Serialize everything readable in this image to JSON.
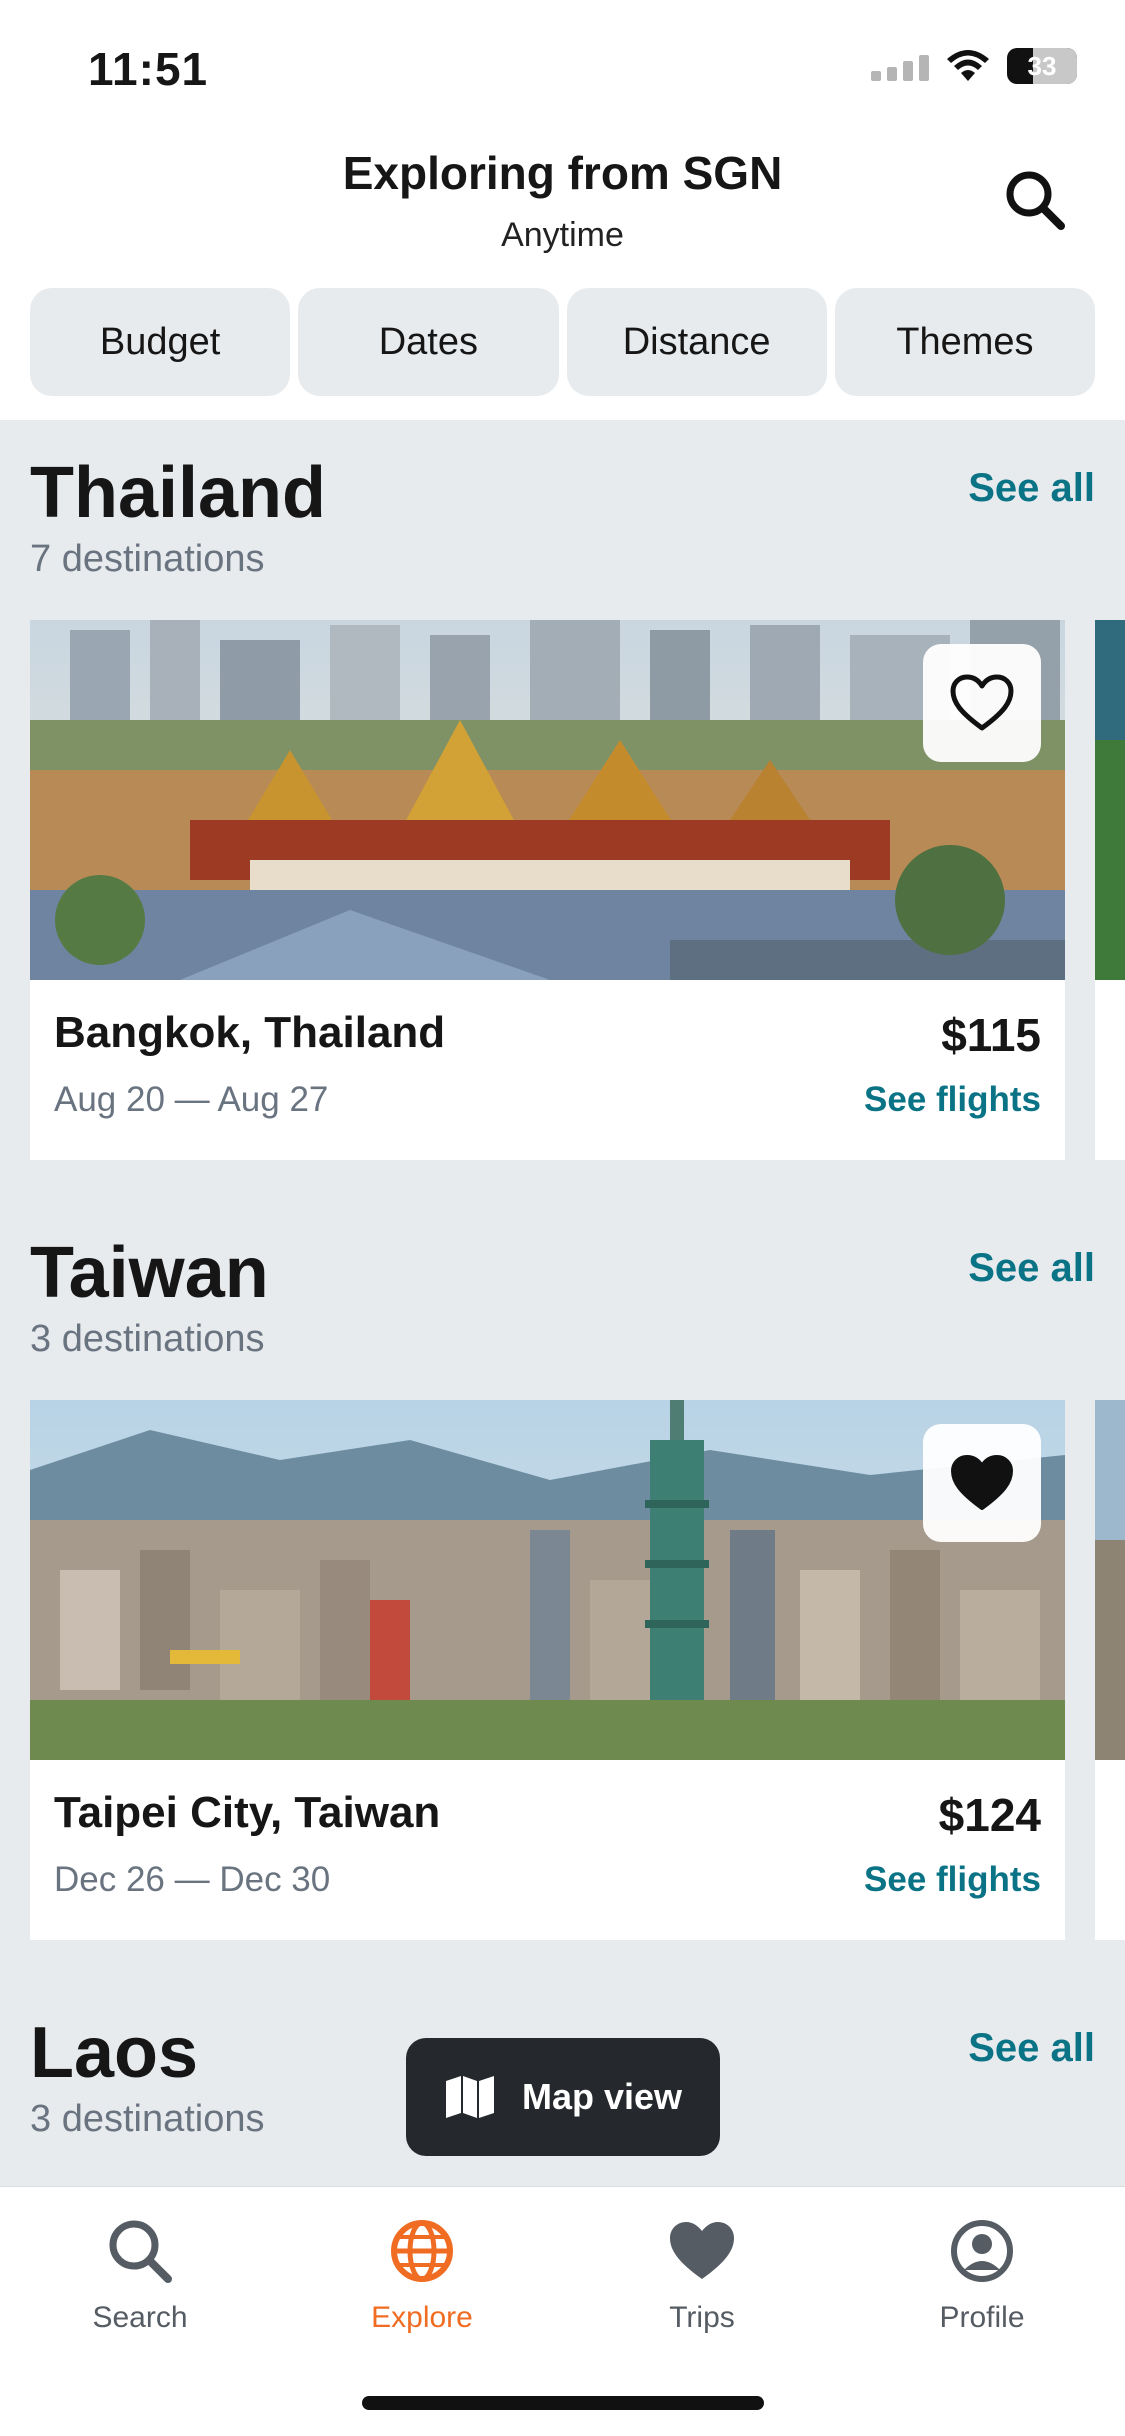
{
  "status_bar": {
    "time": "11:51",
    "battery": "33",
    "icons": [
      "signal-icon",
      "wifi-icon",
      "battery-icon"
    ]
  },
  "header": {
    "title": "Exploring from SGN",
    "subtitle": "Anytime",
    "search_icon": "search-icon"
  },
  "filters": [
    {
      "label": "Budget"
    },
    {
      "label": "Dates"
    },
    {
      "label": "Distance"
    },
    {
      "label": "Themes"
    }
  ],
  "sections": [
    {
      "title": "Thailand",
      "count": "7 destinations",
      "see_all": "See all",
      "card": {
        "name": "Bangkok, Thailand",
        "dates": "Aug 20 — Aug 27",
        "price": "$115",
        "cta": "See flights",
        "favorited": false,
        "fav_icon": "heart-outline-icon"
      }
    },
    {
      "title": "Taiwan",
      "count": "3 destinations",
      "see_all": "See all",
      "card": {
        "name": "Taipei City, Taiwan",
        "dates": "Dec 26 — Dec 30",
        "price": "$124",
        "cta": "See flights",
        "favorited": true,
        "fav_icon": "heart-filled-icon"
      }
    },
    {
      "title": "Laos",
      "count": "3 destinations",
      "see_all": "See all"
    }
  ],
  "map_button": {
    "label": "Map view",
    "icon": "map-icon"
  },
  "bottom_nav": [
    {
      "label": "Search",
      "icon": "search-icon",
      "active": false
    },
    {
      "label": "Explore",
      "icon": "globe-icon",
      "active": true
    },
    {
      "label": "Trips",
      "icon": "heart-icon",
      "active": false
    },
    {
      "label": "Profile",
      "icon": "profile-icon",
      "active": false
    }
  ],
  "colors": {
    "accent_teal": "#0b7386",
    "accent_orange": "#f06c22",
    "background": "#e8ebee",
    "dark_button": "#25292d"
  }
}
